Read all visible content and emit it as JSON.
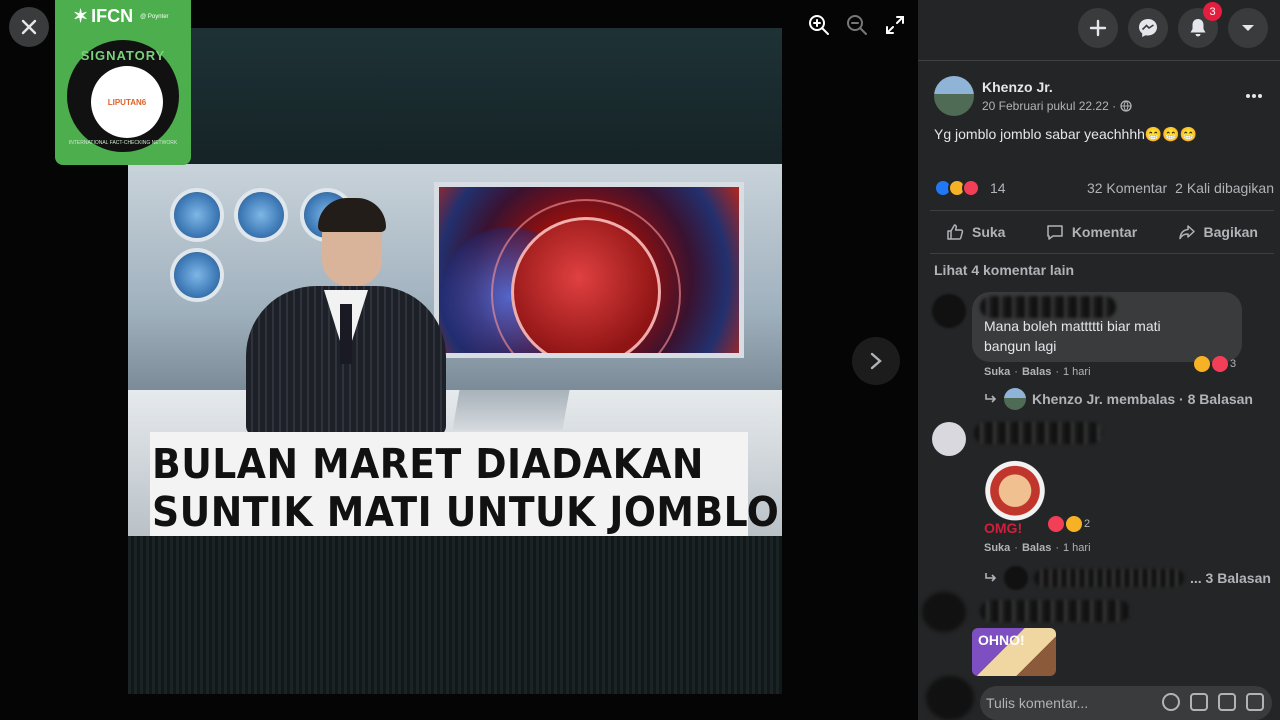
{
  "viewer": {
    "caption_line1": "BULAN MARET DIADAKAN",
    "caption_line2": "SUNTIK MATI UNTUK JOMBLO",
    "badge": {
      "org": "IFCN",
      "by": "@ Poynter",
      "signatory": "SIGNATORY",
      "member": "LIPUTAN6",
      "network": "INTERNATIONAL FACT-CHECKING NETWORK"
    }
  },
  "header": {
    "notifications_count": "3"
  },
  "post": {
    "author": "Khenzo Jr.",
    "date": "20 Februari pukul 22.22 ·",
    "text": "Yg jomblo jomblo sabar yeachhhh😁😁😁",
    "reaction_count": "14",
    "comments_count": "32 Komentar",
    "shares_count": "2 Kali dibagikan",
    "actions": {
      "like": "Suka",
      "comment": "Komentar",
      "share": "Bagikan"
    },
    "more_comments": "Lihat 4 komentar lain"
  },
  "comments": [
    {
      "text_line1": "Mana boleh mattttti biar mati",
      "text_line2": "bangun lagi",
      "reaction_count": "3",
      "like": "Suka",
      "reply": "Balas",
      "time": "1 hari",
      "reply_summary": "Khenzo Jr. membalas · 8 Balasan"
    },
    {
      "sticker_text": "OMG!",
      "reaction_count": "2",
      "like": "Suka",
      "reply": "Balas",
      "time": "1 hari",
      "reply_summary": "... 3 Balasan"
    },
    {
      "sticker_text": "OHNO!"
    }
  ],
  "composer": {
    "placeholder": "Tulis komentar..."
  },
  "colors": {
    "panel_bg": "#242526",
    "bubble_bg": "#3a3b3c",
    "badge_green": "#4cae4c",
    "notif_red": "#e41e3f",
    "like_blue": "#2078f4"
  }
}
